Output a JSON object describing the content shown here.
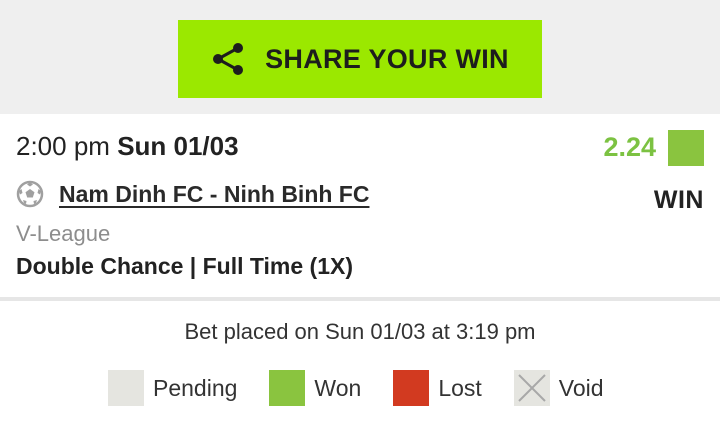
{
  "share": {
    "label": "SHARE YOUR WIN",
    "icon": "share-icon"
  },
  "bet": {
    "time": "2:00 pm",
    "date": "Sun 01/03",
    "odds": "2.24",
    "result": "WIN",
    "status_color": "#8ac43f",
    "sport_icon": "soccer-ball-icon",
    "match": "Nam Dinh FC - Ninh Binh FC",
    "league": "V-League",
    "market": "Double Chance | Full Time (1X)"
  },
  "footer": {
    "placed": "Bet placed on Sun 01/03 at 3:19 pm",
    "legend": [
      {
        "label": "Pending",
        "color": "#e5e5e0"
      },
      {
        "label": "Won",
        "color": "#8ac43f"
      },
      {
        "label": "Lost",
        "color": "#d23a20"
      },
      {
        "label": "Void",
        "color": "#e5e5e0",
        "icon": "cross-icon"
      }
    ]
  },
  "colors": {
    "accent": "#9be800",
    "odds": "#7cc242"
  }
}
